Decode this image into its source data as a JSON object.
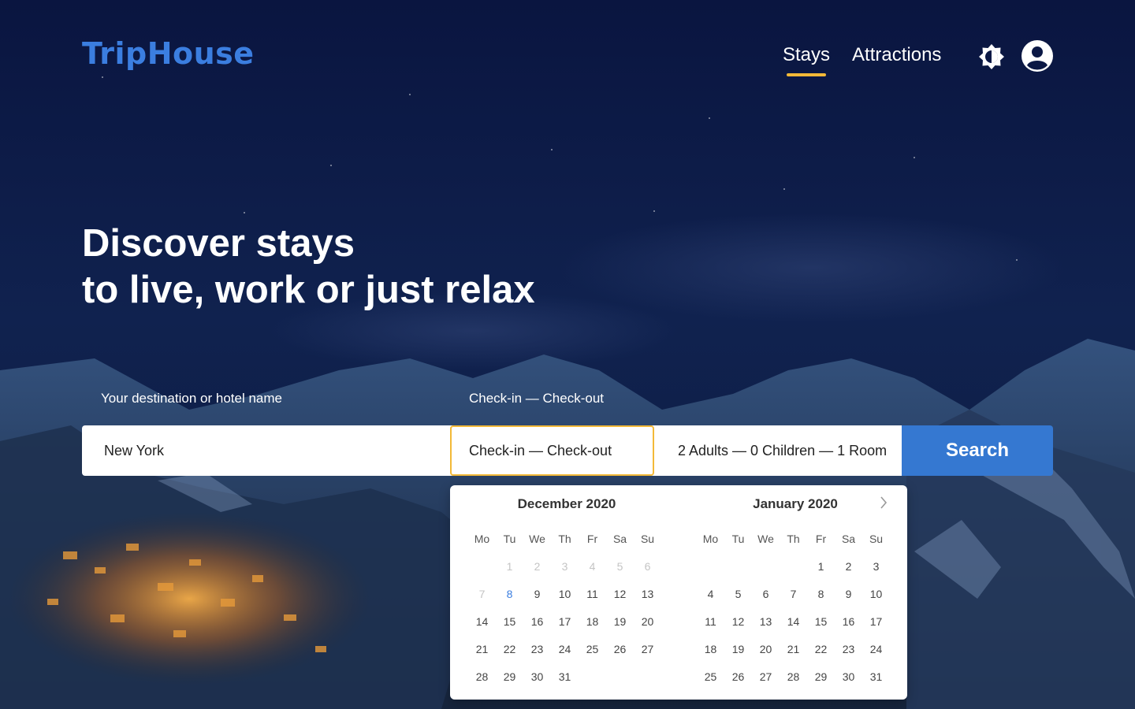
{
  "header": {
    "logo": "TripHouse",
    "nav": [
      {
        "label": "Stays",
        "active": true
      },
      {
        "label": "Attractions",
        "active": false
      }
    ],
    "icons": [
      "brightness-icon",
      "account-icon"
    ]
  },
  "hero": {
    "line1": "Discover stays",
    "line2": "to live, work or just relax"
  },
  "search": {
    "destination_label": "Your destination or hotel name",
    "dates_label": "Check-in — Check-out",
    "destination_value": "New York",
    "dates_placeholder": "Check-in — Check-out",
    "guests_value": "2 Adults — 0 Children — 1 Room",
    "search_button": "Search"
  },
  "calendar": {
    "weekdays": [
      "Mo",
      "Tu",
      "We",
      "Th",
      "Fr",
      "Sa",
      "Su"
    ],
    "months": [
      {
        "title": "December 2020",
        "weeks": [
          [
            "",
            "1",
            "2",
            "3",
            "4",
            "5",
            "6"
          ],
          [
            "7",
            "8",
            "9",
            "10",
            "11",
            "12",
            "13"
          ],
          [
            "14",
            "15",
            "16",
            "17",
            "18",
            "19",
            "20"
          ],
          [
            "21",
            "22",
            "23",
            "24",
            "25",
            "26",
            "27"
          ],
          [
            "28",
            "29",
            "30",
            "31",
            "",
            "",
            ""
          ]
        ],
        "past_days": [
          "1",
          "2",
          "3",
          "4",
          "5",
          "6",
          "7"
        ],
        "today": "8"
      },
      {
        "title": "January 2020",
        "weeks": [
          [
            "",
            "",
            "",
            "",
            "1",
            "2",
            "3"
          ],
          [
            "4",
            "5",
            "6",
            "7",
            "8",
            "9",
            "10"
          ],
          [
            "11",
            "12",
            "13",
            "14",
            "15",
            "16",
            "17"
          ],
          [
            "18",
            "19",
            "20",
            "21",
            "22",
            "23",
            "24"
          ],
          [
            "25",
            "26",
            "27",
            "28",
            "29",
            "30",
            "31"
          ]
        ],
        "past_days": [],
        "today": ""
      }
    ]
  },
  "colors": {
    "accent": "#f3b938",
    "brand": "#3b7ee0",
    "search_button": "#3578d1",
    "sky": "#0b1845"
  }
}
